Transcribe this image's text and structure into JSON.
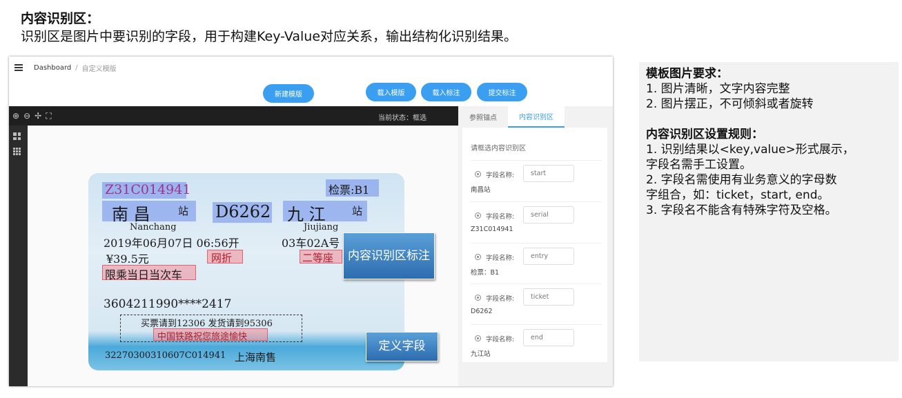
{
  "slide": {
    "heading": "内容识别区：",
    "subheading": "识别区是图片中要识别的字段，用于构建Key-Value对应关系，输出结构化识别结果。"
  },
  "app": {
    "breadcrumb": {
      "home": "Dashboard",
      "separator": "/",
      "current": "自定义模版"
    },
    "buttons": {
      "new_template": "新建模版",
      "load_template": "载入模版",
      "load_annotation": "载入标注",
      "submit_annotation": "提交标注"
    },
    "viewer": {
      "tool_icons": [
        "zoom-in-icon",
        "zoom-out-icon",
        "move-icon",
        "fullscreen-icon"
      ],
      "status_label": "当前状态：",
      "status_value": "框选"
    },
    "panel": {
      "tabs": [
        {
          "label": "参照锚点",
          "active": false
        },
        {
          "label": "内容识别区",
          "active": true
        }
      ],
      "hint": "请框选内容识别区",
      "field_label": "字段名称:",
      "fields": [
        {
          "name": "start",
          "value": "南昌站"
        },
        {
          "name": "serial",
          "value": "Z31C014941"
        },
        {
          "name": "entry",
          "value": "检票：B1"
        },
        {
          "name": "ticket",
          "value": "D6262"
        },
        {
          "name": "end",
          "value": "九江站"
        }
      ]
    }
  },
  "ticket": {
    "serial": "Z31C014941",
    "entry": "检票:B1",
    "from_city": "南  昌",
    "from_suffix": "站",
    "train": "D6262",
    "to_city": "九  江",
    "to_suffix": "站",
    "from_pinyin": "Nanchang",
    "to_pinyin": "Jiujiang",
    "date": "2019年06月07日 06:56开",
    "seat": "03车02A号",
    "price": "¥39.5元",
    "discount": "网折",
    "seat_class": "二等座",
    "restriction": "限乘当日当次车",
    "id_number": "3604211990****2417",
    "hotline": "买票请到12306 发货请到95306",
    "slogan": "中国铁路祝您旅途愉快",
    "bottom_code": "32270300310607C014941",
    "station": "上海南售"
  },
  "callouts": {
    "area_label": "内容识别区标注",
    "field_label": "定义字段"
  },
  "requirements": {
    "title1": "模板图片要求：",
    "items1": [
      "1.   图片清晰，文字内容完整",
      "2.   图片摆正，不可倾斜或者旋转"
    ],
    "title2": "内容识别区设置规则：",
    "lines2": [
      "1. 识别结果以<key,value>形式展示，",
      "字段名需手工设置。",
      "2. 字段名需使用有业务意义的字母数",
      "字组合，如：ticket，start, end。",
      "3. 字段名不能含有特殊字符及空格。"
    ]
  }
}
